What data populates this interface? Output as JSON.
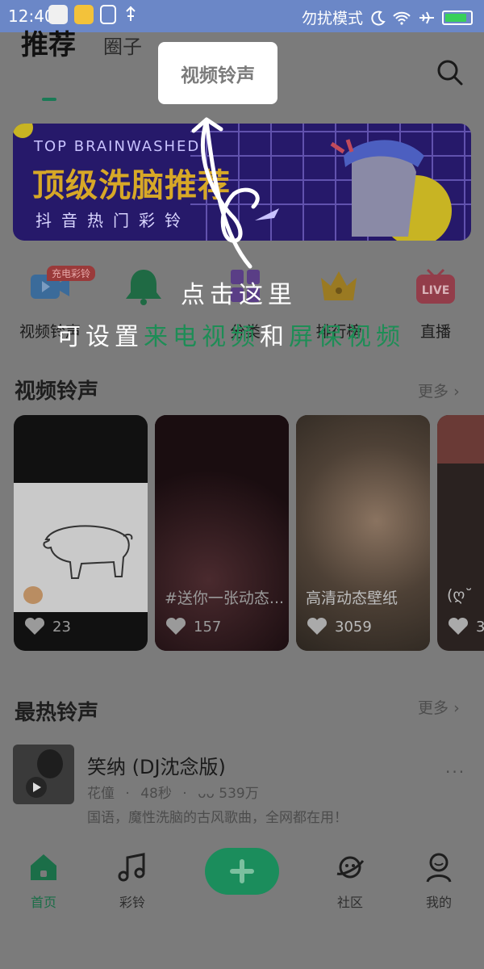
{
  "status_bar": {
    "time": "12:40",
    "dnd_label": "勿扰模式",
    "battery_percent": 90
  },
  "tabs": {
    "recommend": "推荐",
    "circle": "圈子",
    "video_ringtone": "视频铃声"
  },
  "banner": {
    "en": "TOP BRAINWASHED",
    "cn": "顶级洗脑推荐",
    "sub": "抖音热门彩铃"
  },
  "categories": [
    {
      "label": "视频铃声",
      "badge": "充电彩铃"
    },
    {
      "label": "铃声"
    },
    {
      "label": "分类"
    },
    {
      "label": "排行榜"
    },
    {
      "label": "直播",
      "icon_text": "LIVE"
    }
  ],
  "hint": {
    "line1": "点击这里",
    "line2_white_a": "可设置",
    "line2_green_a": "来电视频",
    "line2_white_b": "和",
    "line2_green_b": "屏保视频"
  },
  "video_section": {
    "title": "视频铃声",
    "more": "更多"
  },
  "video_cards": [
    {
      "caption": "",
      "likes": "23"
    },
    {
      "caption": "#送你一张动态...",
      "likes": "157"
    },
    {
      "caption": "高清动态壁纸",
      "likes": "3059"
    },
    {
      "caption": "(ღ˘",
      "likes": "3"
    }
  ],
  "hot_section": {
    "title": "最热铃声",
    "more": "更多"
  },
  "song": {
    "title": "笑纳 (DJ沈念版)",
    "artist": "花僮",
    "duration": "48秒",
    "plays": "539万",
    "desc": "国语，魔性洗脑的古风歌曲，全网都在用！"
  },
  "bottom_nav": {
    "home": "首页",
    "ringtone": "彩铃",
    "community": "社区",
    "mine": "我的"
  },
  "colors": {
    "accent": "#1b8d5c",
    "status_bar": "#6b87c7",
    "overlay": "#7b7b7b"
  }
}
